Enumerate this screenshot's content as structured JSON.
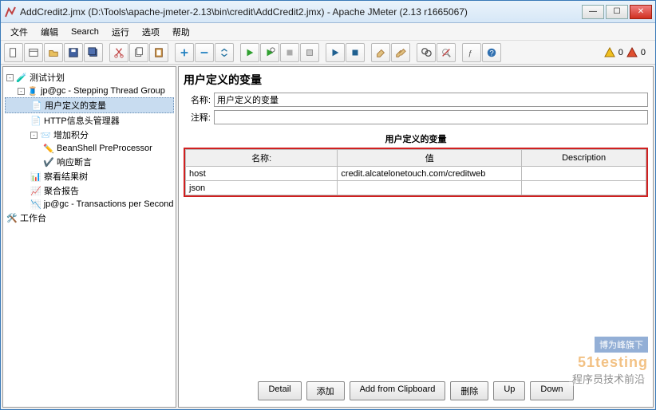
{
  "window": {
    "title": "AddCredit2.jmx (D:\\Tools\\apache-jmeter-2.13\\bin\\credit\\AddCredit2.jmx) - Apache JMeter (2.13 r1665067)"
  },
  "menu": {
    "file": "文件",
    "edit": "编辑",
    "search": "Search",
    "run": "运行",
    "options": "选项",
    "help": "帮助"
  },
  "warn": {
    "tri": "0",
    "err": "0"
  },
  "tree": {
    "root": "测试计划",
    "stg": "jp@gc - Stepping Thread Group",
    "udv": "用户定义的变量",
    "http": "HTTP信息头管理器",
    "add": "增加积分",
    "bsh": "BeanShell PreProcessor",
    "resp": "响应断言",
    "view": "察看结果树",
    "agg": "聚合报告",
    "tps": "jp@gc - Transactions per Second",
    "wb": "工作台"
  },
  "panel": {
    "heading": "用户定义的变量",
    "nameLbl": "名称:",
    "nameVal": "用户定义的变量",
    "commentLbl": "注释:",
    "commentVal": "",
    "section": "用户定义的变量",
    "cols": {
      "name": "名称:",
      "value": "值",
      "desc": "Description"
    },
    "rows": [
      {
        "name": "host",
        "value": "credit.alcatelonetouch.com/creditweb",
        "desc": ""
      },
      {
        "name": "json",
        "value": "",
        "desc": ""
      }
    ],
    "btns": {
      "detail": "Detail",
      "add": "添加",
      "clip": "Add from Clipboard",
      "del": "删除",
      "up": "Up",
      "down": "Down"
    }
  },
  "wm": {
    "tag": "博为峰旗下",
    "brand": "51testing",
    "sub": "程序员技术前沿"
  }
}
